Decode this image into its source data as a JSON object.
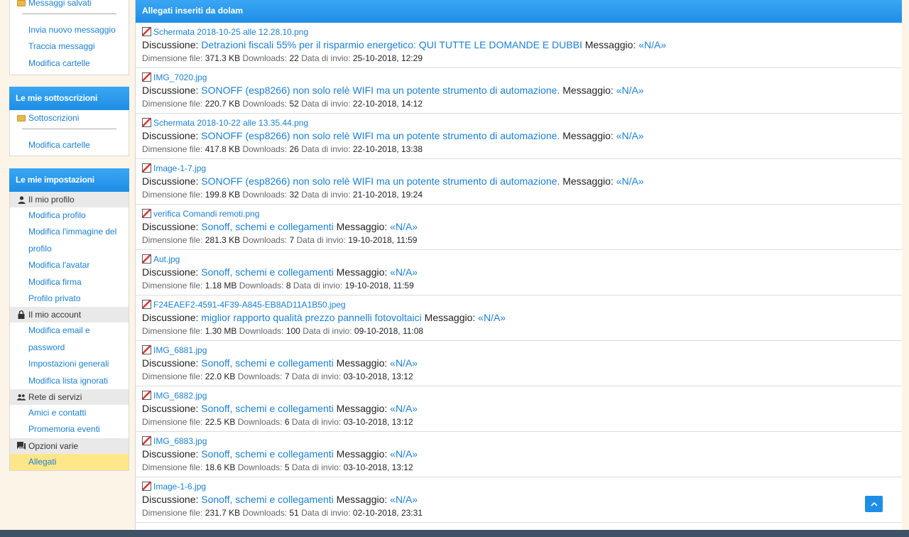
{
  "colors": {
    "accent": "#1e8de5",
    "link": "#1a7fd4",
    "selected": "#ffe789"
  },
  "sidebar": {
    "messages": {
      "saved_label": "Messaggi salvati",
      "items": [
        "Invia nuovo messaggio",
        "Traccia messaggi",
        "Modifica cartelle"
      ]
    },
    "subscriptions": {
      "title": "Le mie sottoscrizioni",
      "folder_label": "Sottoscrizioni",
      "edit_label": "Modifica cartelle"
    },
    "settings": {
      "title": "Le mie impostazioni",
      "profile_cat": "Il mio profilo",
      "profile_items": [
        "Modifica profilo",
        "Modifica l'immagine del profilo",
        "Modifica l'avatar",
        "Modifica firma",
        "Profilo privato"
      ],
      "account_cat": "Il mio account",
      "account_items": [
        "Modifica email e password",
        "Impostazioni generali",
        "Modifica lista ignorati"
      ],
      "network_cat": "Rete di servizi",
      "network_items": [
        "Amici e contatti",
        "Promemoria eventi"
      ],
      "misc_cat": "Opzioni varie",
      "misc_items": [
        "Allegati"
      ]
    }
  },
  "main": {
    "title": "Allegati inseriti da dolam",
    "labels": {
      "discussion": "Discussione:",
      "message": "Messaggio:",
      "size": "Dimensione file:",
      "downloads": "Downloads:",
      "date": "Data di invio:"
    },
    "attachments": [
      {
        "file": "Schermata 2018-10-25 alle 12.28.10.png",
        "thread": "Detrazioni fiscali 55% per il risparmio energetico: QUI TUTTE LE DOMANDE E DUBBI",
        "message": "«N/A»",
        "size": "371.3 KB",
        "downloads": "22",
        "date": "25-10-2018, 12:29"
      },
      {
        "file": "IMG_7020.jpg",
        "thread": "SONOFF (esp8266) non solo relè WIFI ma un potente strumento di automazione.",
        "message": "«N/A»",
        "size": "220.7 KB",
        "downloads": "52",
        "date": "22-10-2018, 14:12"
      },
      {
        "file": "Schermata 2018-10-22 alle 13.35.44.png",
        "thread": "SONOFF (esp8266) non solo relè WIFI ma un potente strumento di automazione.",
        "message": "«N/A»",
        "size": "417.8 KB",
        "downloads": "26",
        "date": "22-10-2018, 13:38"
      },
      {
        "file": "Image-1-7.jpg",
        "thread": "SONOFF (esp8266) non solo relè WIFI ma un potente strumento di automazione.",
        "message": "«N/A»",
        "size": "199.8 KB",
        "downloads": "32",
        "date": "21-10-2018, 19:24"
      },
      {
        "file": "verifica Comandi remoti.png",
        "thread": "Sonoff, schemi e collegamenti",
        "message": "«N/A»",
        "size": "281.3 KB",
        "downloads": "7",
        "date": "19-10-2018, 11:59"
      },
      {
        "file": "Aut.jpg",
        "thread": "Sonoff, schemi e collegamenti",
        "message": "«N/A»",
        "size": "1.18 MB",
        "downloads": "8",
        "date": "19-10-2018, 11:59"
      },
      {
        "file": "F24EAEF2-4591-4F39-A845-EB8AD11A1B50.jpeg",
        "thread": "miglior rapporto qualità prezzo pannelli fotovoltaici",
        "message": "«N/A»",
        "size": "1.30 MB",
        "downloads": "100",
        "date": "09-10-2018, 11:08"
      },
      {
        "file": "IMG_6881.jpg",
        "thread": "Sonoff, schemi e collegamenti",
        "message": "«N/A»",
        "size": "22.0 KB",
        "downloads": "7",
        "date": "03-10-2018, 13:12"
      },
      {
        "file": "IMG_6882.jpg",
        "thread": "Sonoff, schemi e collegamenti",
        "message": "«N/A»",
        "size": "22.5 KB",
        "downloads": "6",
        "date": "03-10-2018, 13:12"
      },
      {
        "file": "IMG_6883.jpg",
        "thread": "Sonoff, schemi e collegamenti",
        "message": "«N/A»",
        "size": "18.6 KB",
        "downloads": "5",
        "date": "03-10-2018, 13:12"
      },
      {
        "file": "Image-1-6.jpg",
        "thread": "Sonoff, schemi e collegamenti",
        "message": "«N/A»",
        "size": "231.7 KB",
        "downloads": "51",
        "date": "02-10-2018, 23:31"
      }
    ],
    "back_to_top": "^"
  }
}
